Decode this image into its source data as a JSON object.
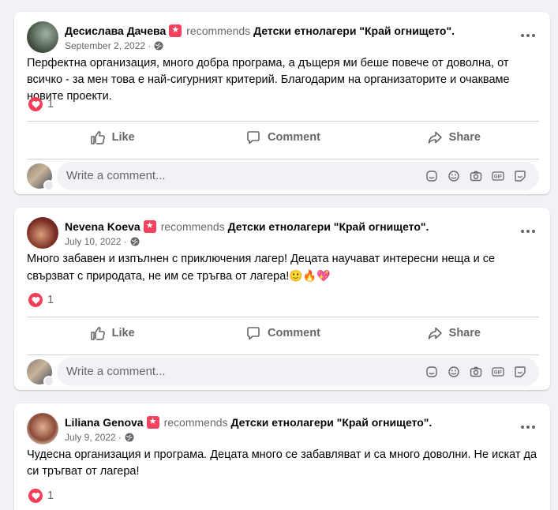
{
  "posts": [
    {
      "author": "Десислава Дачева",
      "recommends": "recommends",
      "page": "Детски етнолагери \"Край огнището\".",
      "date": "September 2, 2022 ·",
      "text": "Перфектна организация, много добра програма, а дъщеря ми беше повече от доволна, от всичко - за мен това е най-сигурният критерий. Благодарим на организаторите и очакваме новите проекти.",
      "reaction_count": "1",
      "like": "Like",
      "comment": "Comment",
      "share": "Share",
      "comment_placeholder": "Write a comment..."
    },
    {
      "author": "Nevena Koeva",
      "recommends": "recommends",
      "page": "Детски етнолагери \"Край огнището\".",
      "date": "July 10, 2022 ·",
      "text": "Много забавен и изпълнен с приключения лагер! Децата научават интересни неща и се свързват с природата, не им се тръгва от лагера!",
      "text_emoji": "🙂🔥💖",
      "reaction_count": "1",
      "like": "Like",
      "comment": "Comment",
      "share": "Share",
      "comment_placeholder": "Write a comment..."
    },
    {
      "author": "Liliana Genova",
      "recommends": "recommends",
      "page": "Детски етнолагери \"Край огнището\".",
      "date": "July 9, 2022 ·",
      "text": "Чудесна организация и програма. Децата много се забавляват и са много доволни. Не искат да си тръгват от лагера!",
      "reaction_count": "1"
    }
  ],
  "colors": {
    "background": "#f0f2f5",
    "recommend_badge": "#f3425f",
    "love_reaction": "#f33e58",
    "secondary_text": "#65676b"
  },
  "icons": [
    "recommend-badge-icon",
    "globe-icon",
    "more-options-icon",
    "love-reaction-icon",
    "like-icon",
    "comment-icon",
    "share-icon",
    "avatar-sticker-icon",
    "emoji-icon",
    "camera-icon",
    "gif-icon",
    "sticker-icon"
  ]
}
